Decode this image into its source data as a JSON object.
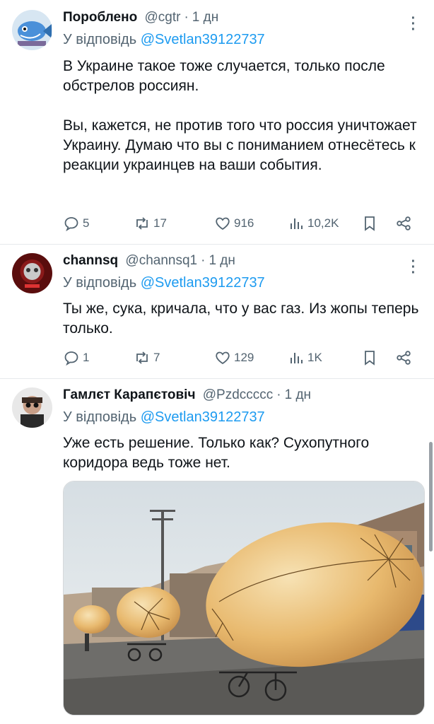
{
  "tweets": [
    {
      "name": "Пороблено",
      "handle": "@cgtr",
      "time": "1 дн",
      "reply_prefix": "У відповідь",
      "reply_to": "@Svetlan39122737",
      "text": "В Украине такое тоже случается, только после обстрелов россиян.\n\nВы, кажется, не против того что россия уничтожает Украину. Думаю что вы с пониманием отнесётесь к реакции украинцев на ваши события.",
      "replies": "5",
      "retweets": "17",
      "likes": "916",
      "views": "10,2K"
    },
    {
      "name": "channsq",
      "handle": "@channsq1",
      "time": "1 дн",
      "reply_prefix": "У відповідь",
      "reply_to": "@Svetlan39122737",
      "text": "Ты же, сука, кричала, что у вас газ. Из жопы теперь только.",
      "replies": "1",
      "retweets": "7",
      "likes": "129",
      "views": "1K"
    },
    {
      "name": "Гамлєт Карапєтовіч",
      "handle": "@Pzdccccc",
      "time": "1 дн",
      "reply_prefix": "У відповідь",
      "reply_to": "@Svetlan39122737",
      "text": "Уже есть решение. Только как? Сухопутного коридора ведь тоже нет."
    }
  ],
  "icons": {
    "reply": "reply-icon",
    "retweet": "retweet-icon",
    "like": "heart-icon",
    "views": "views-icon",
    "bookmark": "bookmark-icon",
    "share": "share-icon",
    "more": "more-icon"
  },
  "colors": {
    "mention": "#1d9bf0",
    "muted": "#536471",
    "text": "#0f1419"
  }
}
